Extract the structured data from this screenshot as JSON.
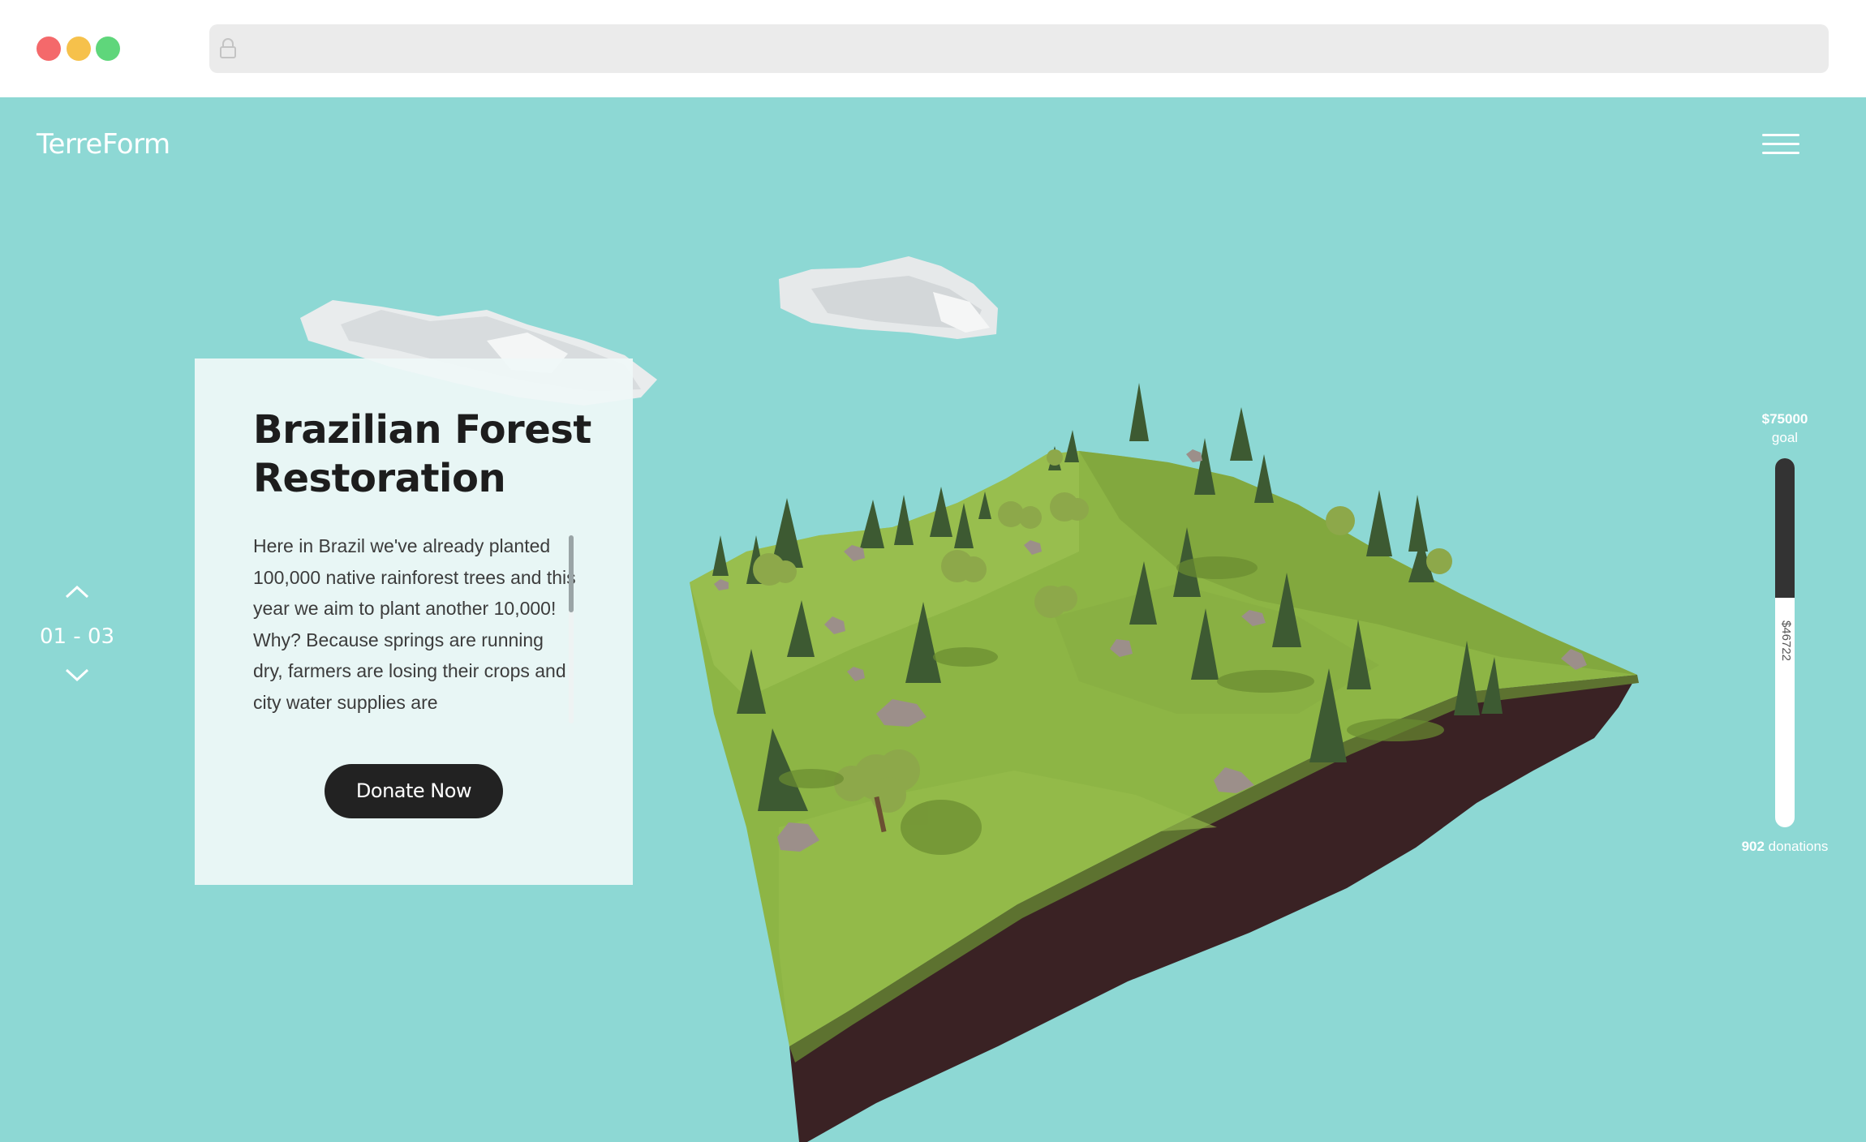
{
  "site": {
    "logo": "TerreForm",
    "menu_icon": "hamburger-menu-icon"
  },
  "project": {
    "title": "Brazilian Forest Restoration",
    "description": "Here in Brazil we've already planted 100,000 native rainforest trees and this year we aim to plant another 10,000! Why? Because springs are running dry, farmers are losing their crops and city water supplies are",
    "donate_label": "Donate Now"
  },
  "pager": {
    "count": "01 - 03",
    "up_icon": "chevron-up-icon",
    "down_icon": "chevron-down-icon"
  },
  "progress": {
    "goal_amount": "$75000",
    "goal_label": "goal",
    "raised_amount": "$46722",
    "donations_count": "902",
    "donations_label": " donations",
    "raised_fraction": 0.377
  },
  "colors": {
    "background": "#8dd8d4",
    "button": "#222222",
    "grass": "#8db545",
    "soil": "#3a2224"
  }
}
